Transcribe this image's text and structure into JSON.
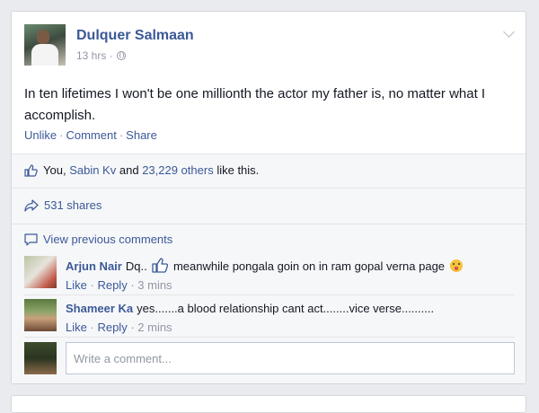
{
  "post": {
    "author": "Dulquer Salmaan",
    "time": "13 hrs ·",
    "text": "In ten lifetimes I won't be one millionth the actor my father is, no matter what I accomplish.",
    "actions": [
      "Unlike",
      "Comment",
      "Share"
    ],
    "action_separator": "·"
  },
  "likes": {
    "you": "You,",
    "friend": "Sabin Kv",
    "and": "and",
    "others": "23,229 others",
    "suffix": "like this."
  },
  "shares": {
    "label": "531 shares"
  },
  "view_previous": {
    "label": "View previous comments"
  },
  "comments": [
    {
      "name": "Arjun Nair",
      "text_before": "Dq..",
      "text_after": "meanwhile pongala goin on in ram gopal verna page",
      "like": "Like",
      "reply": "Reply",
      "time": "· 3 mins"
    },
    {
      "name": "Shameer Ka",
      "text": "yes.......a blood relationship cant act........vice verse..........",
      "like": "Like",
      "reply": "Reply",
      "time": "· 2 mins"
    }
  ],
  "composer": {
    "placeholder": "Write a comment..."
  },
  "colors": {
    "link": "#3b5998",
    "meta": "#9197a3",
    "background": "#e9ebee"
  }
}
